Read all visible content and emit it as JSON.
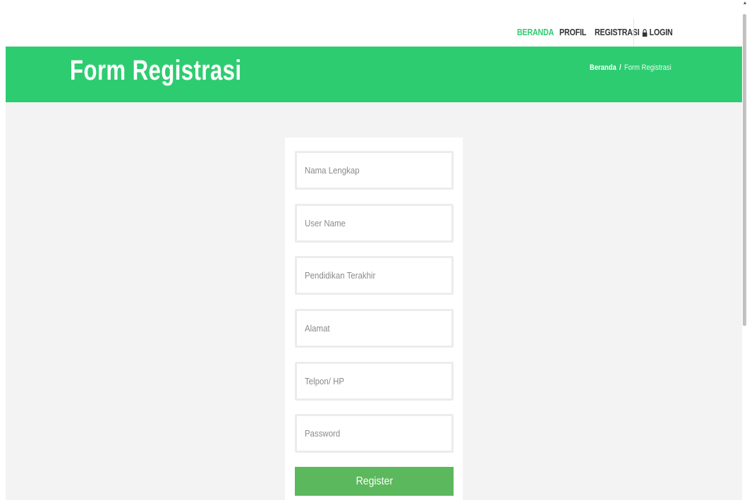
{
  "nav": {
    "items": [
      {
        "label": "BERANDA",
        "active": true
      },
      {
        "label": "PROFIL",
        "active": false
      },
      {
        "label": "REGISTRASI",
        "active": false
      }
    ],
    "login_label": "LOGIN",
    "login_icon": "lock-icon"
  },
  "hero": {
    "title": "Form Registrasi",
    "breadcrumb": {
      "home": "Beranda",
      "separator": "/",
      "current": "Form Registrasi"
    }
  },
  "form": {
    "fields": [
      {
        "name": "nama-lengkap",
        "placeholder": "Nama Lengkap",
        "value": ""
      },
      {
        "name": "user-name",
        "placeholder": "User Name",
        "value": ""
      },
      {
        "name": "pendidikan-terakhir",
        "placeholder": "Pendidikan Terakhir",
        "value": ""
      },
      {
        "name": "alamat",
        "placeholder": "Alamat",
        "value": ""
      },
      {
        "name": "telpon-hp",
        "placeholder": "Telpon/ HP",
        "value": ""
      },
      {
        "name": "password",
        "placeholder": "Password",
        "value": ""
      }
    ],
    "submit_label": "Register"
  },
  "colors": {
    "brand_green": "#2ecc71",
    "button_green": "#5cb85c",
    "content_bg": "#f3f3f3"
  }
}
